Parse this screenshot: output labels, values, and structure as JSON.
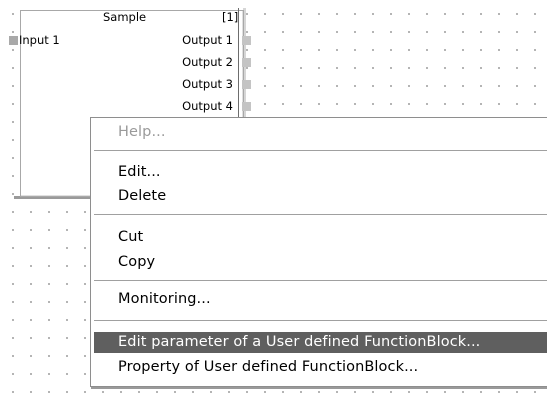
{
  "function_block": {
    "title": "Sample",
    "index": "[1]",
    "input": "Input 1",
    "outputs": [
      "Output 1",
      "Output 2",
      "Output 3",
      "Output 4"
    ]
  },
  "context_menu": {
    "help": "Help...",
    "edit": "Edit...",
    "delete": "Delete",
    "cut": "Cut",
    "copy": "Copy",
    "monitoring": "Monitoring...",
    "edit_parameter": "Edit parameter of a User defined FunctionBlock...",
    "property": "Property of User defined FunctionBlock..."
  },
  "colors": {
    "selected_bg": "#5f5f5f",
    "disabled_text": "#9a9a9a",
    "port_input": "#a9a9a9",
    "port_output": "#c4c4c4"
  }
}
